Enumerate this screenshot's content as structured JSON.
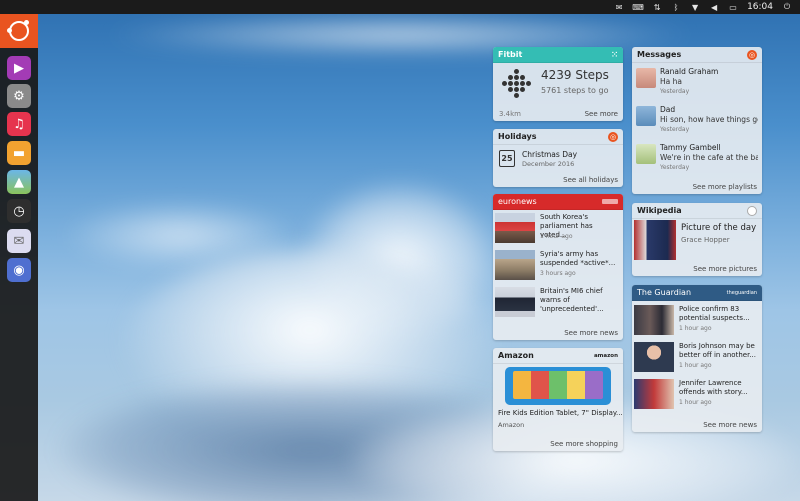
{
  "top_panel": {
    "clock": "16:04",
    "indicators": [
      "mail-icon",
      "keyboard-icon",
      "network-icon",
      "bluetooth-icon",
      "wifi-icon",
      "volume-icon",
      "battery-icon",
      "power-icon"
    ]
  },
  "launcher": {
    "apps": [
      "media-player-icon",
      "settings-icon",
      "music-icon",
      "messaging-icon",
      "gallery-icon",
      "clock-icon",
      "email-icon",
      "browser-icon"
    ]
  },
  "fitbit": {
    "title": "Fitbit",
    "steps": "4239 Steps",
    "remaining": "5761 steps to go",
    "distance": "3.4km",
    "see_more": "See more"
  },
  "holidays": {
    "title": "Holidays",
    "day": "25",
    "event": "Christmas Day",
    "date": "December 2016",
    "see_more": "See all holidays"
  },
  "euronews": {
    "title": "euronews",
    "items": [
      {
        "title": "South Korea's parliament has voted...",
        "time": "1 hour ago"
      },
      {
        "title": "Syria's army has suspended *active*...",
        "time": "3 hours ago"
      },
      {
        "title": "Britain's MI6 chief warns of 'unprecedented'...",
        "time": "6 hours ago"
      }
    ],
    "see_more": "See more news"
  },
  "amazon": {
    "title": "Amazon",
    "brand": "amazon",
    "product": "Fire Kids Edition Tablet, 7\" Display...",
    "seller": "Amazon",
    "see_more": "See more shopping"
  },
  "messages": {
    "title": "Messages",
    "items": [
      {
        "name": "Ranald Graham",
        "text": "Ha ha",
        "time": "Yesterday"
      },
      {
        "name": "Dad",
        "text": "Hi son, how have things gon...",
        "time": "Yesterday"
      },
      {
        "name": "Tammy Gambell",
        "text": "We're in the cafe at the back",
        "time": "Yesterday"
      }
    ],
    "see_more": "See more playlists"
  },
  "wikipedia": {
    "title": "Wikipedia",
    "headline": "Picture of the day",
    "subject": "Grace Hopper",
    "see_more": "See more pictures"
  },
  "guardian": {
    "title": "The Guardian",
    "brand": "theguardian",
    "items": [
      {
        "title": "Police confirm 83 potential suspects...",
        "time": "1 hour ago"
      },
      {
        "title": "Boris Johnson may be better off in another...",
        "time": "1 hour ago"
      },
      {
        "title": "Jennifer Lawrence offends with story...",
        "time": "1 hour ago"
      }
    ],
    "see_more": "See more news"
  },
  "colors": {
    "ubuntu_orange": "#e95420",
    "fitbit_teal": "#34bdb4",
    "euronews_red": "#d72a2a",
    "guardian_blue": "#2f5b85"
  }
}
